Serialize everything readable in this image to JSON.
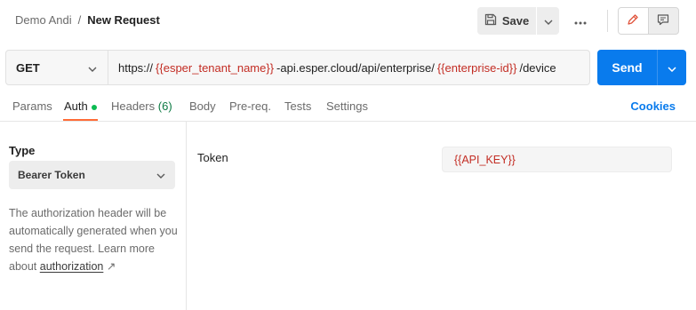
{
  "header": {
    "workspace": "Demo Andi",
    "separator": "/",
    "request_title": "New Request",
    "save_label": "Save"
  },
  "url_bar": {
    "method": "GET",
    "url_parts": [
      {
        "text": "https://",
        "kind": "plain"
      },
      {
        "text": "{{esper_tenant_name}}",
        "kind": "var"
      },
      {
        "text": "-api.esper.cloud/api/enterprise/",
        "kind": "plain"
      },
      {
        "text": "{{enterprise-id}}",
        "kind": "var"
      },
      {
        "text": "/device",
        "kind": "plain"
      }
    ],
    "send_label": "Send"
  },
  "tabs": {
    "params": "Params",
    "auth": "Auth",
    "headers": "Headers",
    "headers_count": "(6)",
    "body": "Body",
    "prereq": "Pre-req.",
    "tests": "Tests",
    "settings": "Settings",
    "cookies": "Cookies"
  },
  "auth": {
    "type_label": "Type",
    "type_value": "Bearer Token",
    "help_text": "The authorization header will be automatically generated when you send the request. Learn more about ",
    "help_link": "authorization",
    "help_arrow": "↗",
    "token_label": "Token",
    "token_value": "{{API_KEY}}"
  },
  "colors": {
    "accent_blue": "#097bed",
    "variable_red": "#c32d24",
    "active_tab_orange": "#ff6c37",
    "status_green": "#0cbb52"
  },
  "icons": {
    "save": "save-disk-icon",
    "more": "more-horizontal-icon",
    "edit": "pencil-icon",
    "docs": "comment-doc-icon",
    "chevron": "chevron-down-icon"
  }
}
